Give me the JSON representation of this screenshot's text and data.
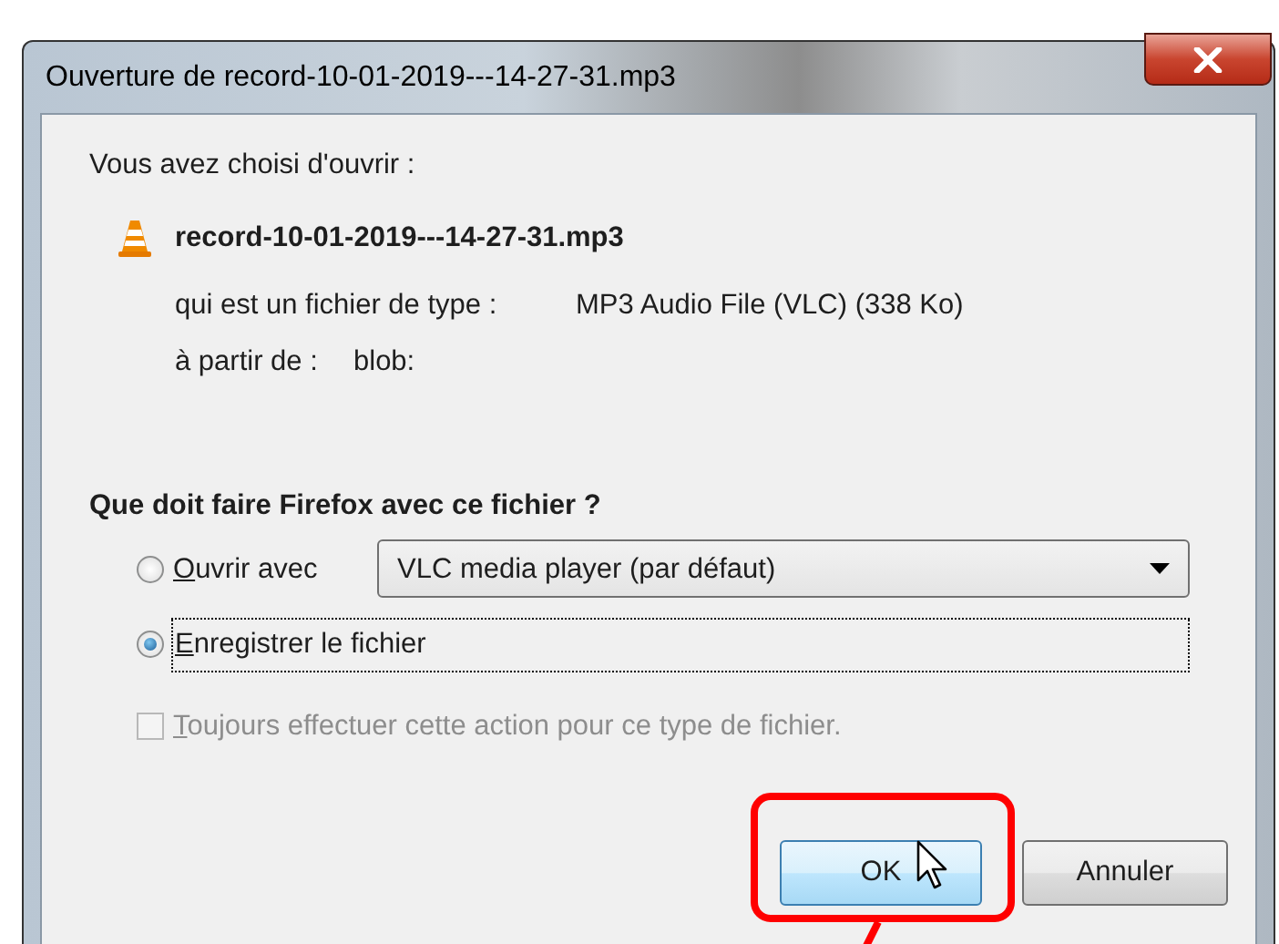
{
  "window": {
    "title": "Ouverture de record-10-01-2019---14-27-31.mp3"
  },
  "intro": "Vous avez choisi d'ouvrir :",
  "file": {
    "name": "record-10-01-2019---14-27-31.mp3",
    "type_label": "qui est un fichier de type :",
    "type_value": "MP3 Audio File (VLC) (338 Ko)",
    "source_label": "à partir de :",
    "source_value": "blob:"
  },
  "question": "Que doit faire Firefox avec ce fichier ?",
  "options": [
    {
      "kind": "open_with",
      "label": "Ouvrir avec",
      "selected": false,
      "app": "VLC media player (par défaut)"
    },
    {
      "kind": "save",
      "label": "Enregistrer le fichier",
      "selected": true
    }
  ],
  "always": {
    "label": "Toujours effectuer cette action pour ce type de fichier.",
    "checked": false,
    "disabled": true
  },
  "buttons": [
    {
      "label": "OK",
      "default": true
    },
    {
      "label": "Annuler",
      "default": false
    }
  ]
}
